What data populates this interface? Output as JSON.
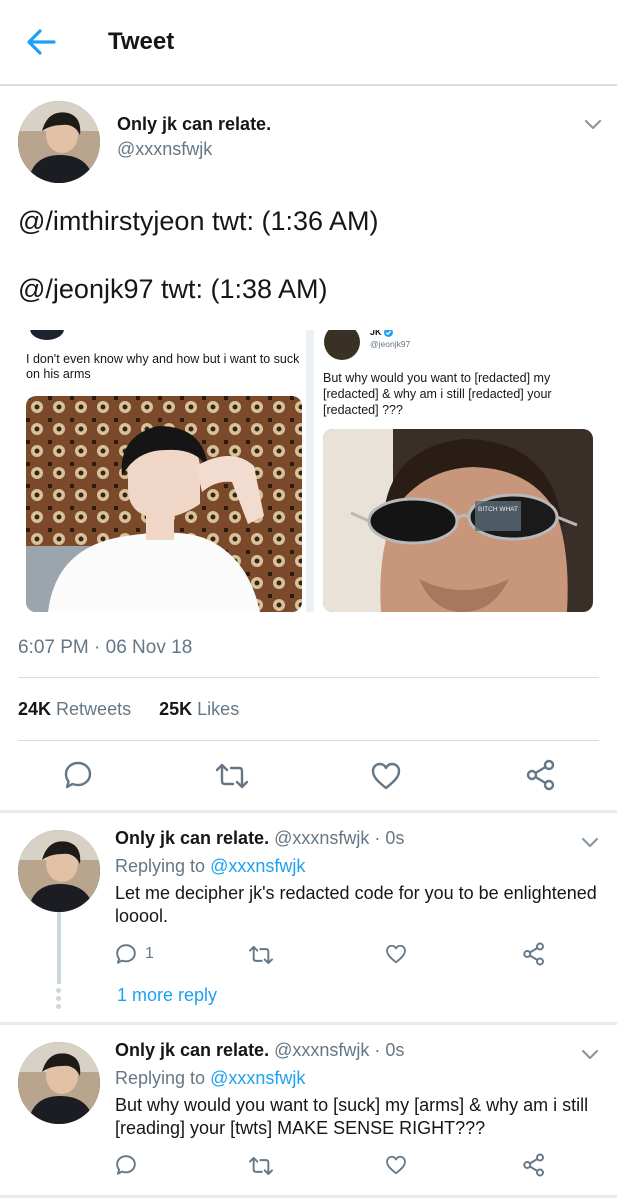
{
  "header": {
    "title": "Tweet"
  },
  "main_tweet": {
    "name": "Only jk can relate.",
    "handle": "@xxxnsfwjk",
    "line1": "@/imthirstyjeon twt: (1:36 AM)",
    "line2": "@/jeonjk97 twt: (1:38 AM)",
    "timestamp": "6:07 PM · 06 Nov 18",
    "retweets_count": "24K",
    "retweets_label": "Retweets",
    "likes_count": "25K",
    "likes_label": "Likes"
  },
  "media": {
    "left": {
      "text": "I don't even know why and how but i want to suck on his arms"
    },
    "right": {
      "name": "JK",
      "handle": "@jeonjk97",
      "text": "But why would you want to [redacted] my [redacted] & why am i still [redacted] your [redacted] ???",
      "sunglasses_text": "BITCH WHAT"
    }
  },
  "replies": [
    {
      "name": "Only jk can relate.",
      "handle": "@xxxnsfwjk · 0s",
      "replying_label": "Replying to",
      "replying_handle": "@xxxnsfwjk",
      "text": "Let me decipher jk's redacted code for you to be enlightened looool.",
      "reply_count": "1",
      "more_replies": "1 more reply"
    },
    {
      "name": "Only jk can relate.",
      "handle": "@xxxnsfwjk · 0s",
      "replying_label": "Replying to",
      "replying_handle": "@xxxnsfwjk",
      "text": "But why would you want to [suck] my [arms] & why am i still [reading] your [twts] MAKE SENSE RIGHT???"
    }
  ],
  "icons": {
    "back": "arrow-left-icon",
    "chevron": "chevron-down-icon",
    "reply": "comment-icon",
    "retweet": "retweet-icon",
    "like": "heart-icon",
    "share": "share-icon"
  },
  "colors": {
    "accent": "#1da1f2",
    "text": "#14171a",
    "muted": "#657786",
    "border": "#d8dde1"
  }
}
